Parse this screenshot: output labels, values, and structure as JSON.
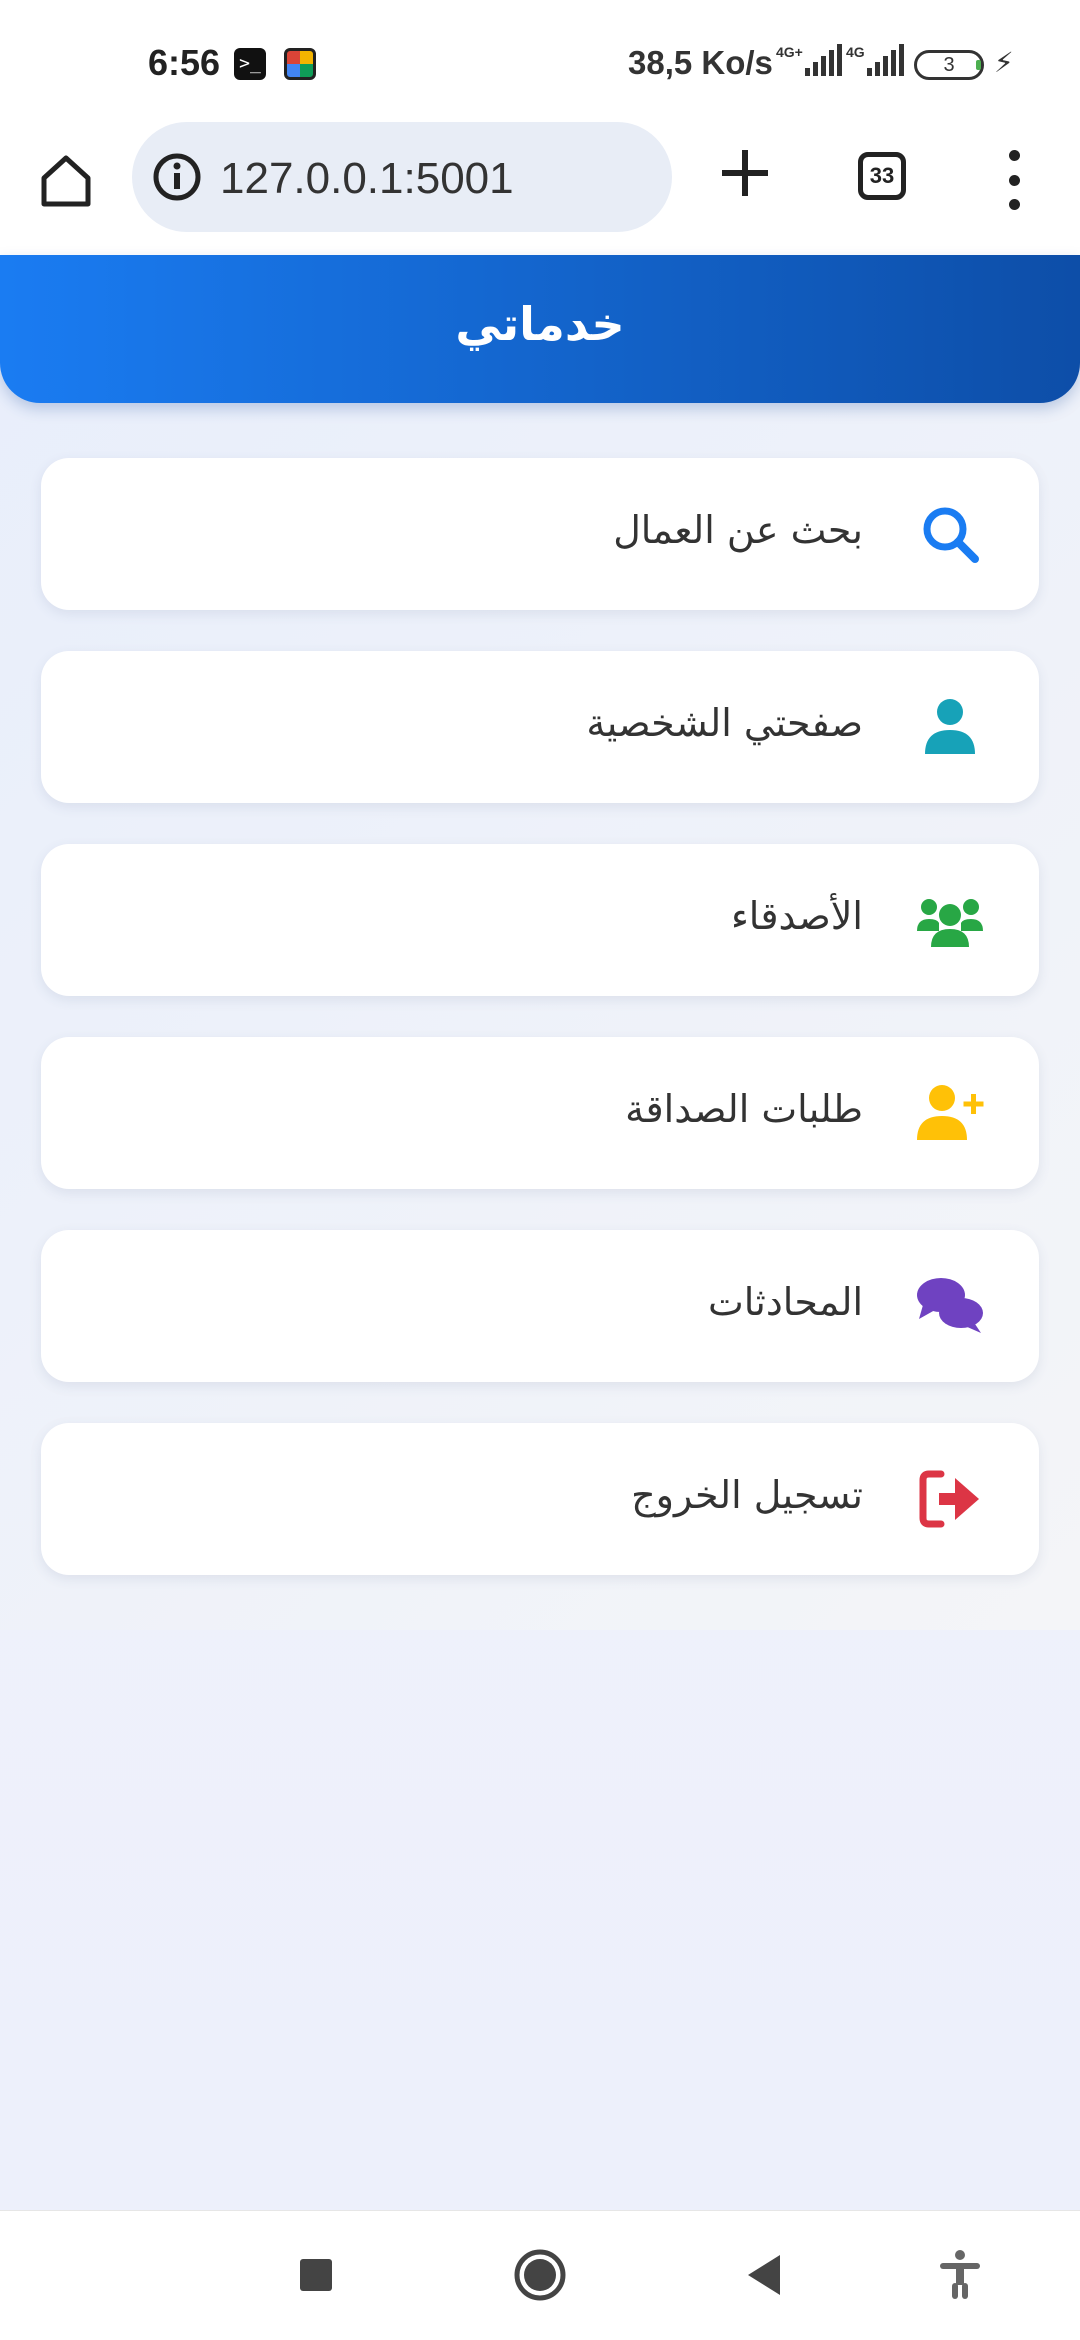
{
  "status_bar": {
    "time": "6:56",
    "speed": "38,5 Ko/s",
    "network1": "4G+",
    "network2": "4G",
    "battery": "3"
  },
  "browser": {
    "url": "127.0.0.1:5001",
    "tab_count": "33"
  },
  "app": {
    "title": "خدماتي",
    "menu": [
      {
        "label": "بحث عن العمال",
        "icon": "search-icon",
        "color": "#1a7cf2"
      },
      {
        "label": "صفحتي الشخصية",
        "icon": "user-icon",
        "color": "#17a2b8"
      },
      {
        "label": "الأصدقاء",
        "icon": "users-icon",
        "color": "#28a745"
      },
      {
        "label": "طلبات الصداقة",
        "icon": "user-plus-icon",
        "color": "#ffc107"
      },
      {
        "label": "المحادثات",
        "icon": "comments-icon",
        "color": "#6f42c1"
      },
      {
        "label": "تسجيل الخروج",
        "icon": "sign-out-icon",
        "color": "#dc3545"
      }
    ]
  }
}
